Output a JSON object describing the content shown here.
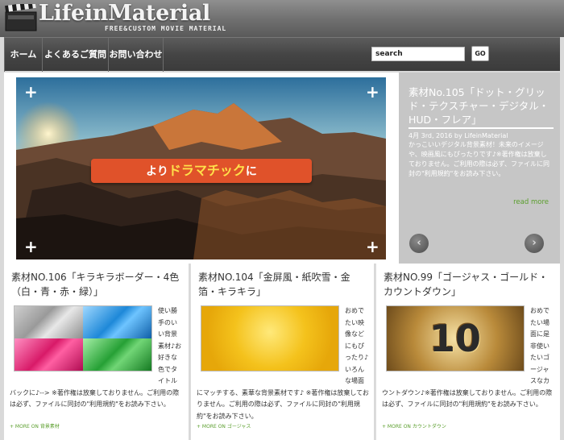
{
  "header": {
    "title": "LifeinMaterial",
    "tagline": "FREE&CUSTOM MOVIE MATERIAL"
  },
  "nav": {
    "items": [
      "ホーム",
      "よくあるご質問",
      "お問い合わせ"
    ]
  },
  "search": {
    "value": "search",
    "button_label": "GO"
  },
  "slider": {
    "banner_prefix": "より",
    "banner_highlight": "ドラマチック",
    "banner_suffix": "に",
    "title": "素材No.105「ドット・グリッド・テクスチャー・デジタル・HUD・フレア」",
    "meta": "4月 3rd, 2016 by LifeinMaterial",
    "description": "かっこいいデジタル背景素材！未来のイメージや、映画風にもぴったりです♪※著作権は放棄しておりません。ご利用の際は必ず、ファイルに同封の\"利用規約\"をお読み下さい。",
    "read_more": "read more",
    "prev_icon": "‹",
    "next_icon": "›"
  },
  "cards": [
    {
      "title": "素材NO.106「キラキラボーダー・4色（白・青・赤・緑）」",
      "excerpt": "使い勝手のいい背景素材♪お好きな色でタイトルバックに♪--> ※著作権は放棄しておりません。ご利用の際は必ず、ファイルに同封の\"利用規約\"をお読み下さい。",
      "more_label": "+ MORE ON",
      "category": "背景素材"
    },
    {
      "title": "素材NO.104「金屏風・紙吹雪・金箔・キラキラ」",
      "excerpt": "おめでたい映像などにもぴったり♪いろんな場面にマッチする、素華な背景素材です♪ ※著作権は放棄しておりません。ご利用の際は必ず、ファイルに同封の\"利用規約\"をお読み下さい。",
      "more_label": "+ MORE ON",
      "category": "ゴージャス"
    },
    {
      "title": "素材NO.99「ゴージャス・ゴールド・カウントダウン」",
      "excerpt": "おめでたい場面に是非使いたいゴージャスなカウントダウン♪※著作権は放棄しておりません。ご利用の際は必ず、ファイルに同封の\"利用規約\"をお読み下さい。",
      "more_label": "+ MORE ON",
      "category": "カウントダウン",
      "thumb_number": "10"
    }
  ],
  "colors": {
    "accent_green": "#5a9e2c",
    "banner_orange": "#e0522a"
  }
}
